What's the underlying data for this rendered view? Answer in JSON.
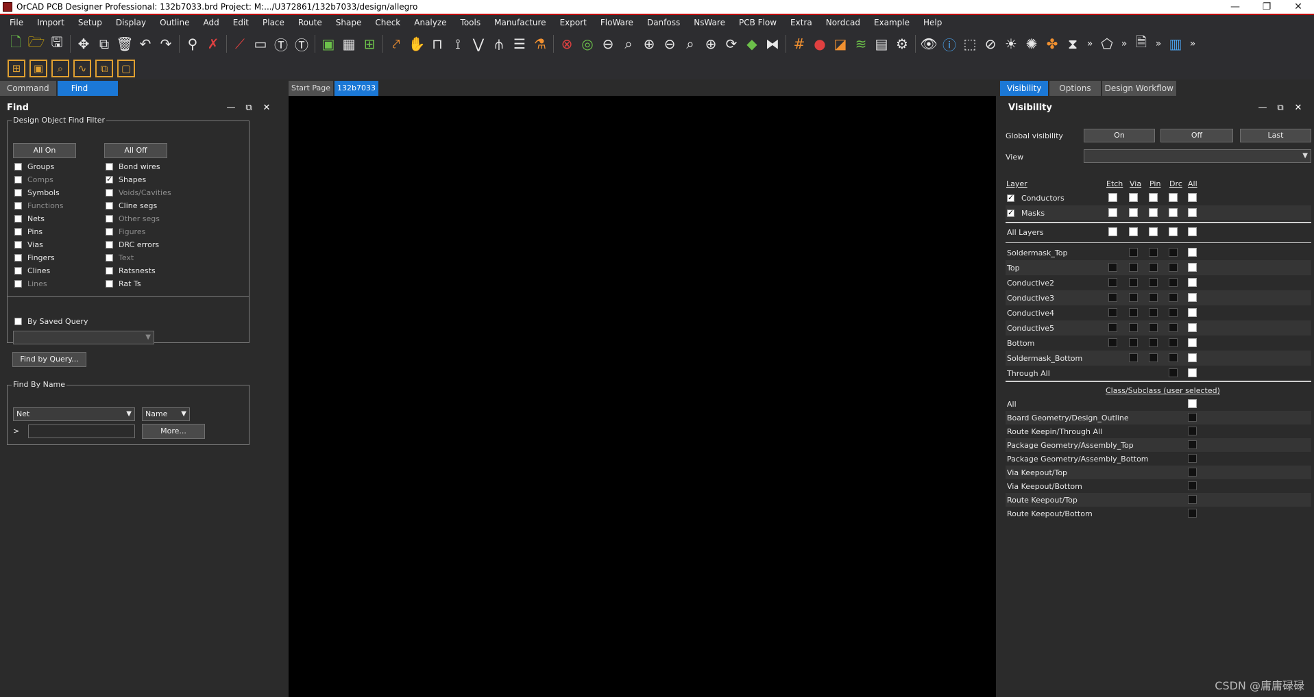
{
  "titlebar": {
    "title": "OrCAD PCB Designer Professional: 132b7033.brd  Project: M:.../U372861/132b7033/design/allegro",
    "minimize": "—",
    "restore": "❐",
    "close": "✕"
  },
  "menu": [
    "File",
    "Import",
    "Setup",
    "Display",
    "Outline",
    "Add",
    "Edit",
    "Place",
    "Route",
    "Shape",
    "Check",
    "Analyze",
    "Tools",
    "Manufacture",
    "Export",
    "FloWare",
    "Danfoss",
    "NsWare",
    "PCB Flow",
    "Extra",
    "Nordcad",
    "Example",
    "Help"
  ],
  "left": {
    "tabs": [
      "Command",
      "Find"
    ],
    "panel_title": "Find",
    "filter_title": "Design Object Find Filter",
    "all_on": "All On",
    "all_off": "All Off",
    "col1": [
      {
        "label": "Groups",
        "checked": false,
        "dim": false
      },
      {
        "label": "Comps",
        "checked": false,
        "dim": true
      },
      {
        "label": "Symbols",
        "checked": false,
        "dim": false
      },
      {
        "label": "Functions",
        "checked": false,
        "dim": true
      },
      {
        "label": "Nets",
        "checked": false,
        "dim": false
      },
      {
        "label": "Pins",
        "checked": false,
        "dim": false
      },
      {
        "label": "Vias",
        "checked": false,
        "dim": false
      },
      {
        "label": "Fingers",
        "checked": false,
        "dim": false
      },
      {
        "label": "Clines",
        "checked": false,
        "dim": false
      },
      {
        "label": "Lines",
        "checked": false,
        "dim": true
      }
    ],
    "col2": [
      {
        "label": "Bond wires",
        "checked": false,
        "dim": false
      },
      {
        "label": "Shapes",
        "checked": true,
        "dim": false
      },
      {
        "label": "Voids/Cavities",
        "checked": false,
        "dim": true
      },
      {
        "label": "Cline segs",
        "checked": false,
        "dim": false
      },
      {
        "label": "Other segs",
        "checked": false,
        "dim": true
      },
      {
        "label": "Figures",
        "checked": false,
        "dim": true
      },
      {
        "label": "DRC errors",
        "checked": false,
        "dim": false
      },
      {
        "label": "Text",
        "checked": false,
        "dim": true
      },
      {
        "label": "Ratsnests",
        "checked": false,
        "dim": false
      },
      {
        "label": "Rat Ts",
        "checked": false,
        "dim": false
      }
    ],
    "by_saved_query": "By Saved Query",
    "find_by_query": "Find by Query...",
    "find_by_name_title": "Find By Name",
    "name_type": "Net",
    "name_mode": "Name",
    "prompt": ">",
    "more": "More..."
  },
  "center": {
    "tabs": [
      "Start Page",
      "132b7033"
    ]
  },
  "right": {
    "tabs": [
      "Visibility",
      "Options",
      "Design Workflow"
    ],
    "panel_title": "Visibility",
    "global_visibility": "Global visibility",
    "on": "On",
    "off": "Off",
    "last": "Last",
    "view": "View",
    "layer_hdr": "Layer",
    "col_hdrs": [
      "Etch",
      "Via",
      "Pin",
      "Drc",
      "All"
    ],
    "top_rows": [
      {
        "label": "Conductors",
        "checked": true
      },
      {
        "label": "Masks",
        "checked": true
      }
    ],
    "all_layers": "All Layers",
    "layers": [
      {
        "label": "Soldermask_Top",
        "etch": false,
        "via": true,
        "pin": true,
        "drc": true
      },
      {
        "label": "Top",
        "etch": true,
        "via": true,
        "pin": true,
        "drc": true
      },
      {
        "label": "Conductive2",
        "etch": true,
        "via": true,
        "pin": true,
        "drc": true
      },
      {
        "label": "Conductive3",
        "etch": true,
        "via": true,
        "pin": true,
        "drc": true
      },
      {
        "label": "Conductive4",
        "etch": true,
        "via": true,
        "pin": true,
        "drc": true
      },
      {
        "label": "Conductive5",
        "etch": true,
        "via": true,
        "pin": true,
        "drc": true
      },
      {
        "label": "Bottom",
        "etch": true,
        "via": true,
        "pin": true,
        "drc": true
      },
      {
        "label": "Soldermask_Bottom",
        "etch": false,
        "via": true,
        "pin": true,
        "drc": true
      },
      {
        "label": "Through All",
        "etch": false,
        "via": false,
        "pin": false,
        "drc": true
      }
    ],
    "class_hdr": "Class/Subclass (user selected)",
    "classes": [
      {
        "label": "All",
        "white": true
      },
      {
        "label": "Board Geometry/Design_Outline",
        "white": false
      },
      {
        "label": "Route Keepin/Through All",
        "white": false
      },
      {
        "label": "Package Geometry/Assembly_Top",
        "white": false
      },
      {
        "label": "Package Geometry/Assembly_Bottom",
        "white": false
      },
      {
        "label": "Via Keepout/Top",
        "white": false
      },
      {
        "label": "Via Keepout/Bottom",
        "white": false
      },
      {
        "label": "Route Keepout/Top",
        "white": false
      },
      {
        "label": "Route Keepout/Bottom",
        "white": false
      }
    ]
  },
  "watermark": "CSDN @庸庸碌碌"
}
